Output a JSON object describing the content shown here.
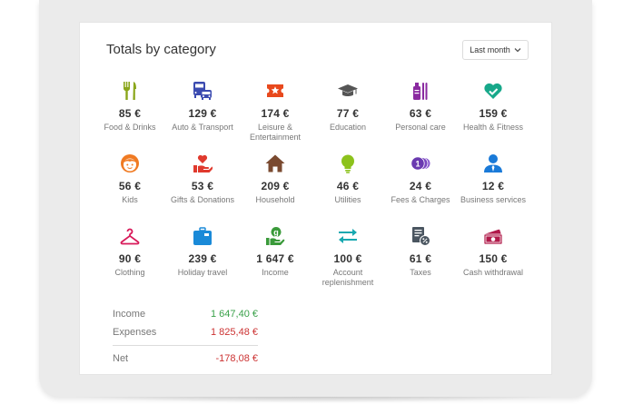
{
  "card": {
    "title": "Totals by category",
    "period_label": "Last month"
  },
  "categories": [
    {
      "icon": "fork-knife-icon",
      "color": "#8aa61a",
      "amount": "85 €",
      "label": "Food & Drinks"
    },
    {
      "icon": "bus-car-icon",
      "color": "#3b4bb0",
      "amount": "129 €",
      "label": "Auto & Transport"
    },
    {
      "icon": "ticket-star-icon",
      "color": "#e8491d",
      "amount": "174 €",
      "label": "Leisure & Entertainment"
    },
    {
      "icon": "graduation-cap-icon",
      "color": "#555555",
      "amount": "77 €",
      "label": "Education"
    },
    {
      "icon": "personal-care-icon",
      "color": "#8a2aa0",
      "amount": "63 €",
      "label": "Personal care"
    },
    {
      "icon": "heart-check-icon",
      "color": "#17a88a",
      "amount": "159 €",
      "label": "Health & Fitness"
    },
    {
      "icon": "kid-face-icon",
      "color": "#f07a22",
      "amount": "56 €",
      "label": "Kids"
    },
    {
      "icon": "gift-hand-icon",
      "color": "#e03a2e",
      "amount": "53 €",
      "label": "Gifts & Donations"
    },
    {
      "icon": "house-icon",
      "color": "#7a4a30",
      "amount": "209 €",
      "label": "Household"
    },
    {
      "icon": "lightbulb-icon",
      "color": "#8cc21c",
      "amount": "46 €",
      "label": "Utilities"
    },
    {
      "icon": "coins-icon",
      "color": "#6a3ab0",
      "amount": "24 €",
      "label": "Fees & Charges"
    },
    {
      "icon": "business-person-icon",
      "color": "#1a7ad8",
      "amount": "12 €",
      "label": "Business services"
    },
    {
      "icon": "hanger-icon",
      "color": "#d81a5a",
      "amount": "90 €",
      "label": "Clothing"
    },
    {
      "icon": "suitcase-icon",
      "color": "#1a8ad8",
      "amount": "239 €",
      "label": "Holiday travel"
    },
    {
      "icon": "income-hand-icon",
      "color": "#3a9a3a",
      "amount": "1 647 €",
      "label": "Income"
    },
    {
      "icon": "transfer-arrows-icon",
      "color": "#17a8b0",
      "amount": "100 €",
      "label": "Account replenishment"
    },
    {
      "icon": "tax-document-icon",
      "color": "#4a5560",
      "amount": "61 €",
      "label": "Taxes"
    },
    {
      "icon": "cash-withdrawal-icon",
      "color": "#b01a4a",
      "amount": "150 €",
      "label": "Cash withdrawal"
    }
  ],
  "totals": {
    "income_label": "Income",
    "income_value": "1 647,40 €",
    "income_color": "#3aa14a",
    "expenses_label": "Expenses",
    "expenses_value": "1 825,48 €",
    "expenses_color": "#cc3333",
    "net_label": "Net",
    "net_value": "-178,08 €",
    "net_color": "#cc3333"
  }
}
